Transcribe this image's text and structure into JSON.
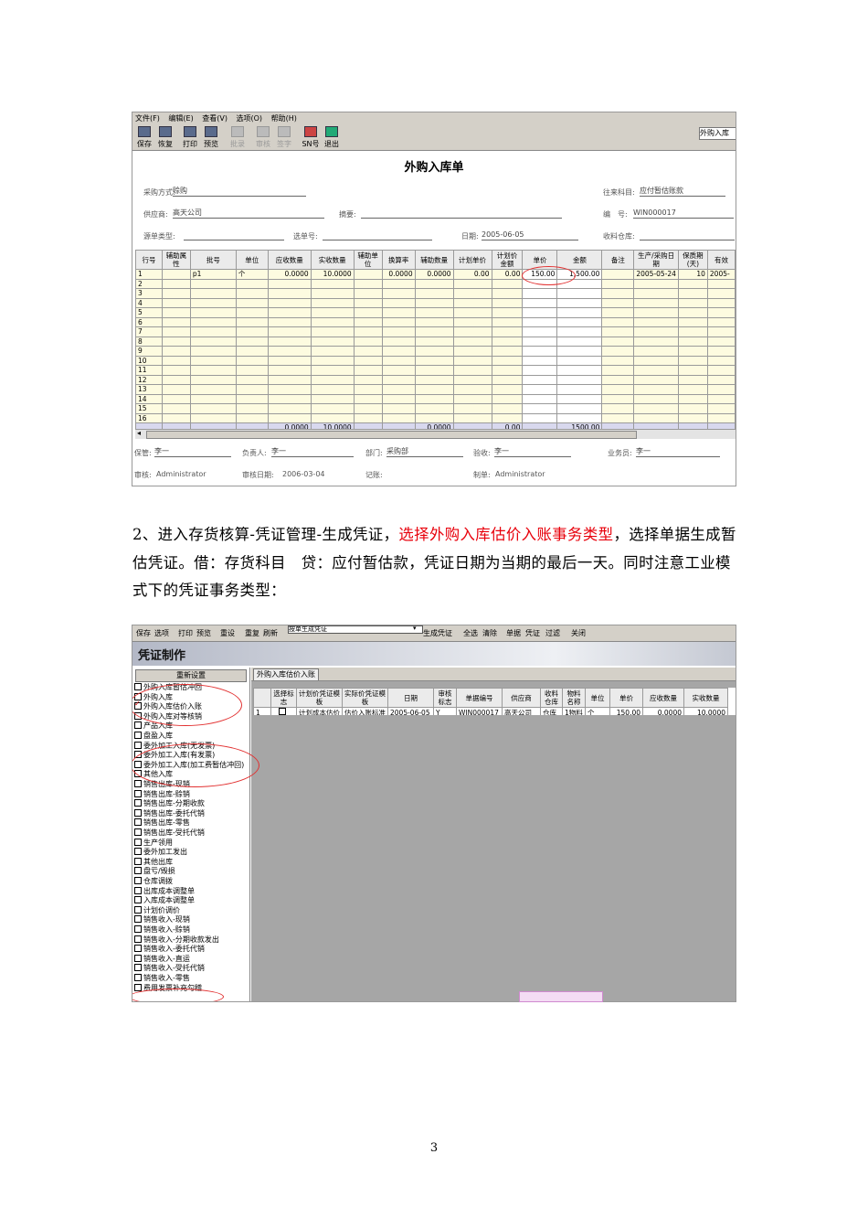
{
  "shot1": {
    "menu": [
      "文件(F)",
      "编辑(E)",
      "查看(V)",
      "选项(O)",
      "帮助(H)"
    ],
    "toolbar": [
      {
        "label": "保存",
        "icon": "save-icon",
        "enabled": true
      },
      {
        "label": "恢复",
        "icon": "undo-icon",
        "enabled": true
      },
      {
        "label": "打印",
        "icon": "print-icon",
        "enabled": true
      },
      {
        "label": "预览",
        "icon": "preview-icon",
        "enabled": true
      },
      {
        "label": "批录",
        "icon": "batch-icon",
        "enabled": false
      },
      {
        "label": "审核",
        "icon": "audit-icon",
        "enabled": false
      },
      {
        "label": "签字",
        "icon": "sign-icon",
        "enabled": false
      },
      {
        "label": "SN号",
        "icon": "sn-icon",
        "enabled": true
      },
      {
        "label": "退出",
        "icon": "exit-icon",
        "enabled": true
      }
    ],
    "type_select": "外购入库",
    "title": "外购入库单",
    "fields": {
      "purchase_mode_label": "采购方式:",
      "purchase_mode": "赊购",
      "account_label": "往来科目:",
      "account": "应付暂估账款",
      "supplier_label": "供应商:",
      "supplier": "高天公司",
      "summary_label": "摘要:",
      "summary": "",
      "number_label": "编　号:",
      "number": "WIN000017",
      "src_type_label": "源单类型:",
      "src_type": "",
      "select_no_label": "选单号:",
      "select_no": "",
      "date_label": "日期:",
      "date": "2005-06-05",
      "warehouse_label": "收料仓库:",
      "warehouse": ""
    },
    "columns": [
      "行号",
      "辅助属性",
      "批号",
      "单位",
      "应收数量",
      "实收数量",
      "辅助单位",
      "换算率",
      "辅助数量",
      "计划单价",
      "计划价金额",
      "单价",
      "金额",
      "备注",
      "生产/采购日期",
      "保质期(天)",
      "有效"
    ],
    "row1": [
      "1",
      "",
      "p1",
      "个",
      "0.0000",
      "10.0000",
      "",
      "0.0000",
      "0.0000",
      "0.00",
      "0.00",
      "150.00",
      "1,500.00",
      "",
      "2005-05-24",
      "10",
      "2005-"
    ],
    "empty_rows": [
      "2",
      "3",
      "4",
      "5",
      "6",
      "7",
      "8",
      "9",
      "10",
      "11",
      "12",
      "13",
      "14",
      "15",
      "16"
    ],
    "sum_row": [
      "",
      "",
      "",
      "",
      "0.0000",
      "10.0000",
      "",
      "",
      "0.0000",
      "",
      "0.00",
      "",
      "1500.00",
      "",
      "",
      "",
      ""
    ],
    "footer": {
      "keeper_label": "保管:",
      "keeper": "李一",
      "manager_label": "负责人:",
      "manager": "李一",
      "dept_label": "部门:",
      "dept": "采购部",
      "inspector_label": "验收:",
      "inspector": "李一",
      "salesman_label": "业务员:",
      "salesman": "李一",
      "auditor_label": "审核:",
      "auditor": "Administrator",
      "audit_date_label": "审核日期:",
      "audit_date": "2006-03-04",
      "posted_label": "记账:",
      "posted": "",
      "maker_label": "制单:",
      "maker": "Administrator"
    }
  },
  "paragraph": {
    "part1": "2、进入存货核算-凭证管理-生成凭证，",
    "part2_red": "选择外购入库估价入账事务类型",
    "part3": "，选择单据生成暂估凭证。借：存货科目　贷：应付暂估款，凭证日期为当期的最后一天。同时注意工业模式下的凭证事务类型："
  },
  "shot2": {
    "toolbar": [
      "保存",
      "选项",
      "打印",
      "预览",
      "重设",
      "重复",
      "刷新",
      "生成凭证",
      "全选",
      "清除",
      "单据",
      "凭证",
      "过滤",
      "关闭"
    ],
    "combo": "按单生成凭证",
    "banner": "凭证制作",
    "reset": "重新设置",
    "items": [
      {
        "label": "外购入库暂估冲回",
        "checked": false
      },
      {
        "label": "外购入库",
        "checked": false
      },
      {
        "label": "外购入库估价入账",
        "checked": true
      },
      {
        "label": "外购入库对等核销",
        "checked": false
      },
      {
        "label": "产品入库",
        "checked": false
      },
      {
        "label": "盘盈入库",
        "checked": false
      },
      {
        "label": "委外加工入库(无发票)",
        "checked": false
      },
      {
        "label": "委外加工入库(有发票)",
        "checked": false
      },
      {
        "label": "委外加工入库(加工费暂估冲回)",
        "checked": false
      },
      {
        "label": "其他入库",
        "checked": false
      },
      {
        "label": "销售出库-现销",
        "checked": false
      },
      {
        "label": "销售出库-赊销",
        "checked": false
      },
      {
        "label": "销售出库-分期收款",
        "checked": false
      },
      {
        "label": "销售出库-委托代销",
        "checked": false
      },
      {
        "label": "销售出库-零售",
        "checked": false
      },
      {
        "label": "销售出库-受托代销",
        "checked": false
      },
      {
        "label": "生产领用",
        "checked": false
      },
      {
        "label": "委外加工发出",
        "checked": false
      },
      {
        "label": "其他出库",
        "checked": false
      },
      {
        "label": "盘亏/毁损",
        "checked": false
      },
      {
        "label": "仓库调拨",
        "checked": false
      },
      {
        "label": "出库成本调整单",
        "checked": false
      },
      {
        "label": "入库成本调整单",
        "checked": false
      },
      {
        "label": "计划价调价",
        "checked": false
      },
      {
        "label": "销售收入-现销",
        "checked": false
      },
      {
        "label": "销售收入-赊销",
        "checked": false
      },
      {
        "label": "销售收入-分期收款发出",
        "checked": false
      },
      {
        "label": "销售收入-委托代销",
        "checked": false
      },
      {
        "label": "销售收入-直运",
        "checked": false
      },
      {
        "label": "销售收入-受托代销",
        "checked": false
      },
      {
        "label": "销售收入-零售",
        "checked": false
      },
      {
        "label": "费用发票补充勾稽",
        "checked": false
      }
    ],
    "tab": "外购入库估价入账",
    "columns": [
      "",
      "选择标志",
      "计划价凭证模板",
      "实际价凭证模板",
      "日期",
      "审核标志",
      "单据编号",
      "供应商",
      "收料仓库",
      "物料名称",
      "单位",
      "单价",
      "应收数量",
      "实收数量"
    ],
    "row": [
      "1",
      "",
      "计划成本估价",
      "估价入账标准",
      "2005-06-05",
      "Y",
      "WIN000017",
      "高天公司",
      "仓库",
      "1物料",
      "个",
      "150.00",
      "0.0000",
      "10.0000"
    ]
  },
  "page_number": "3"
}
